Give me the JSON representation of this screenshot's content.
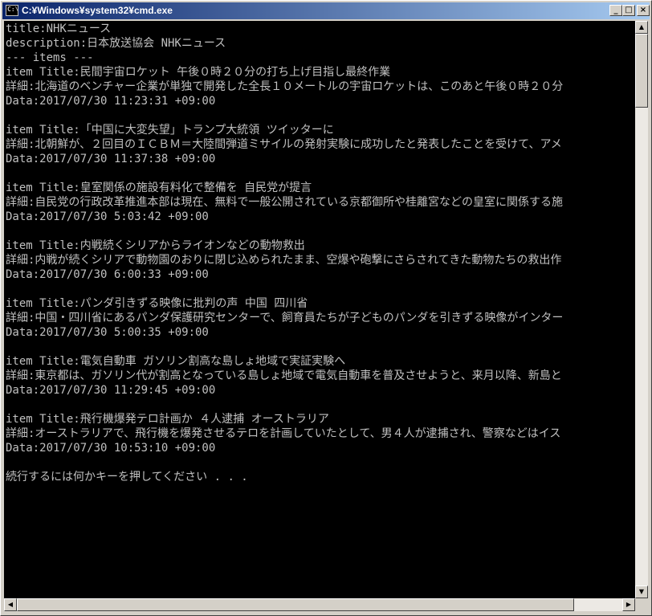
{
  "window": {
    "title": "C:¥Windows¥system32¥cmd.exe",
    "icon_label": "C:\\",
    "min_glyph": "_",
    "max_glyph": "□",
    "close_glyph": "×"
  },
  "console_lines": [
    "title:NHKニュース",
    "description:日本放送協会 NHKニュース",
    "--- items ---",
    "item Title:民間宇宙ロケット 午後０時２０分の打ち上げ目指し最終作業",
    "詳細:北海道のベンチャー企業が単独で開発した全長１０メートルの宇宙ロケットは、このあと午後０時２０分",
    "Data:2017/07/30 11:23:31 +09:00",
    "",
    "item Title:「中国に大変失望」トランプ大統領 ツイッターに",
    "詳細:北朝鮮が、２回目のＩＣＢＭ＝大陸間弾道ミサイルの発射実験に成功したと発表したことを受けて、アメ",
    "Data:2017/07/30 11:37:38 +09:00",
    "",
    "item Title:皇室関係の施設有料化で整備を 自民党が提言",
    "詳細:自民党の行政改革推進本部は現在、無料で一般公開されている京都御所や桂離宮などの皇室に関係する施",
    "Data:2017/07/30 5:03:42 +09:00",
    "",
    "item Title:内戦続くシリアからライオンなどの動物救出",
    "詳細:内戦が続くシリアで動物園のおりに閉じ込められたまま、空爆や砲撃にさらされてきた動物たちの救出作",
    "Data:2017/07/30 6:00:33 +09:00",
    "",
    "item Title:パンダ引きずる映像に批判の声 中国 四川省",
    "詳細:中国・四川省にあるパンダ保護研究センターで、飼育員たちが子どものパンダを引きずる映像がインター",
    "Data:2017/07/30 5:00:35 +09:00",
    "",
    "item Title:電気自動車 ガソリン割高な島しょ地域で実証実験へ",
    "詳細:東京都は、ガソリン代が割高となっている島しょ地域で電気自動車を普及させようと、来月以降、新島と",
    "Data:2017/07/30 11:29:45 +09:00",
    "",
    "item Title:飛行機爆発テロ計画か ４人逮捕 オーストラリア",
    "詳細:オーストラリアで、飛行機を爆発させるテロを計画していたとして、男４人が逮捕され、警察などはイス",
    "Data:2017/07/30 10:53:10 +09:00",
    "",
    "続行するには何かキーを押してください . . ."
  ],
  "scrollbars": {
    "up_glyph": "▲",
    "down_glyph": "▼",
    "left_glyph": "◀",
    "right_glyph": "▶"
  }
}
